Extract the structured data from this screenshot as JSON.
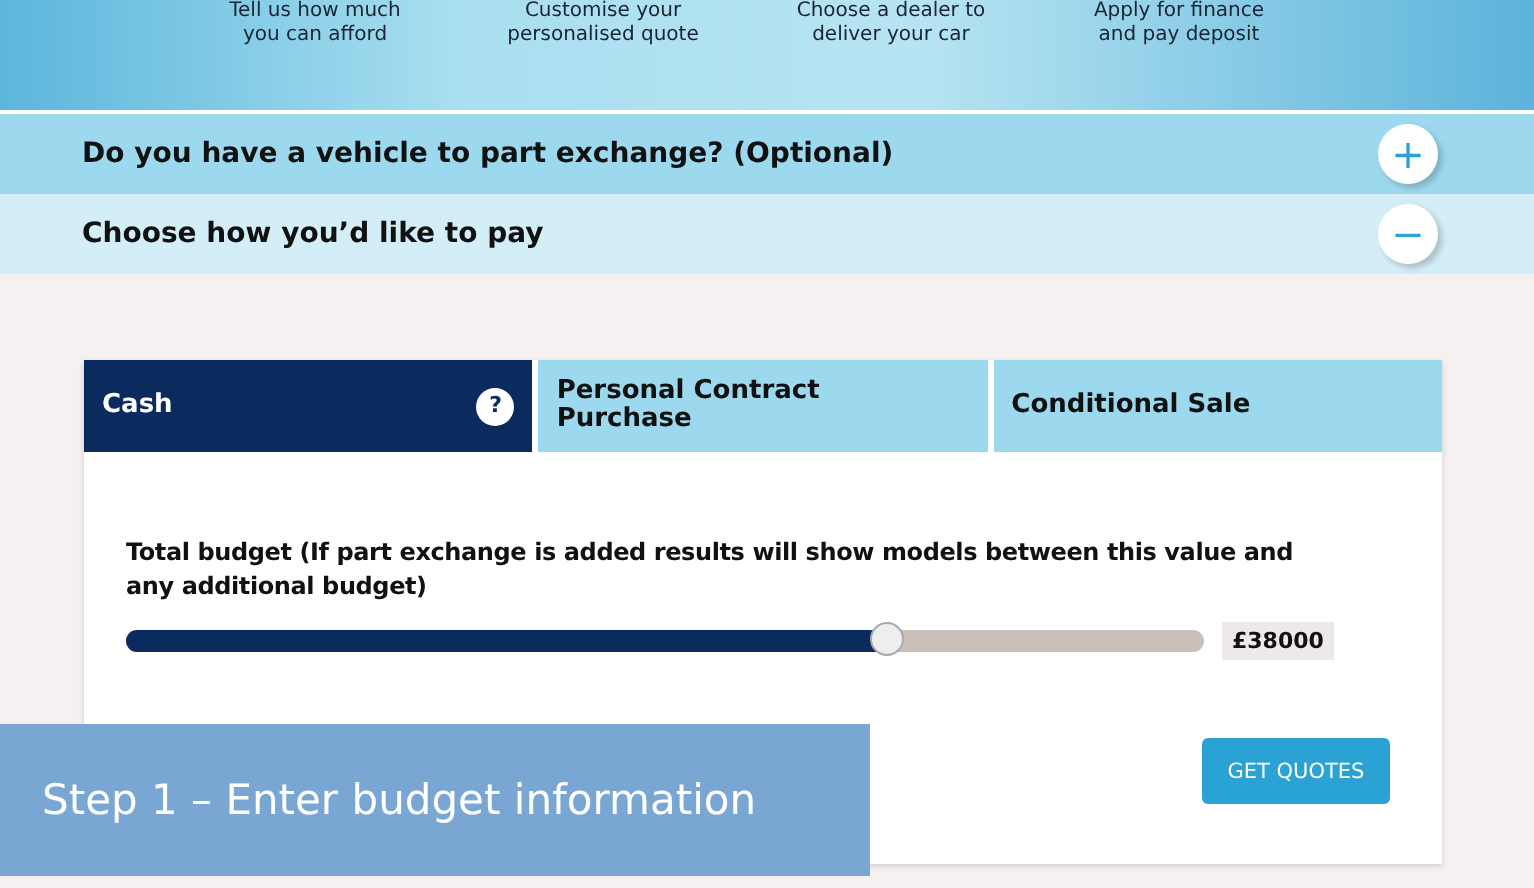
{
  "steps": [
    {
      "text": "Tell us how much\nyou can afford"
    },
    {
      "text": "Customise your\npersonalised quote"
    },
    {
      "text": "Choose a dealer to\ndeliver your car"
    },
    {
      "text": "Apply for finance\nand pay deposit"
    }
  ],
  "sections": [
    {
      "title": "Do you have a vehicle to part exchange? (Optional)",
      "expanded": false,
      "toggle": "+"
    },
    {
      "title": "Choose how you’d like to pay",
      "expanded": true,
      "toggle": "−"
    }
  ],
  "payment_tabs": [
    {
      "label": "Cash",
      "selected": true,
      "help": "?"
    },
    {
      "label": "Personal Contract Purchase",
      "selected": false
    },
    {
      "label": "Conditional Sale",
      "selected": false
    }
  ],
  "budget": {
    "label": "Total budget (If part exchange is added results will show models between this value and any additional budget)",
    "level": 0.707,
    "value": "£38000"
  },
  "button": "GET QUOTES",
  "caption": "Step 1 – Enter budget information"
}
